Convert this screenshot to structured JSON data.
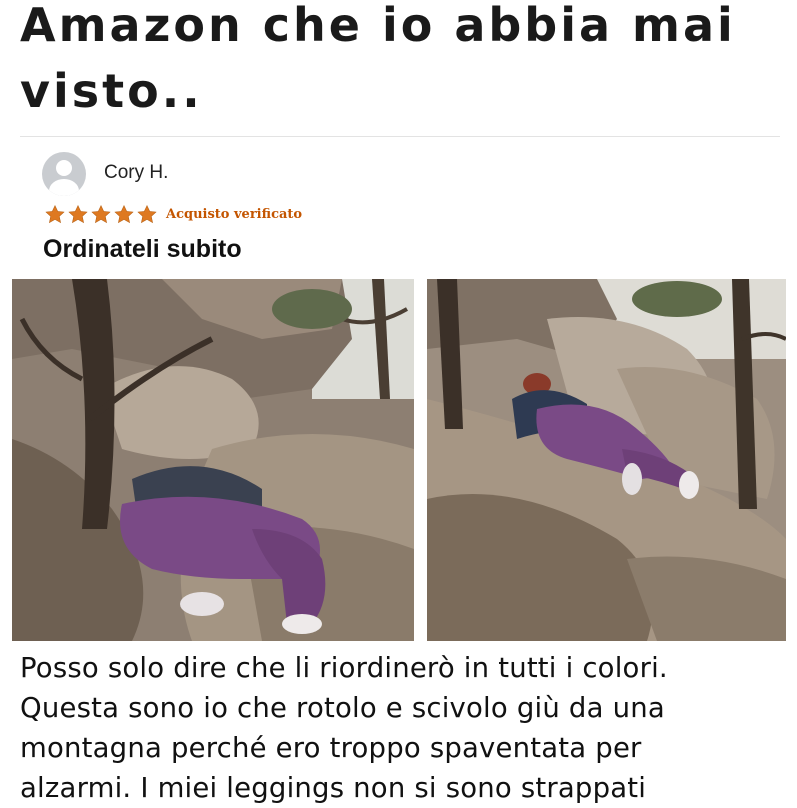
{
  "headline": "Amazon che io abbia mai visto..",
  "review": {
    "reviewer_name": "Cory H.",
    "avatar_icon": "user-avatar-icon",
    "rating": 5,
    "rating_max": 5,
    "star_color": "#de7921",
    "verified_label": "Acquisto verificato",
    "verified_color": "#c45500",
    "title": "Ordinateli subito",
    "photos": [
      {
        "name": "review-photo-1"
      },
      {
        "name": "review-photo-2"
      }
    ],
    "body": "Posso solo dire che li riordinerò in tutti i colori.\nQuesta sono io che rotolo e scivolo giù da una\nmontagna perché ero troppo spaventata per\nalzarmi. I miei leggings non si sono strappati"
  }
}
